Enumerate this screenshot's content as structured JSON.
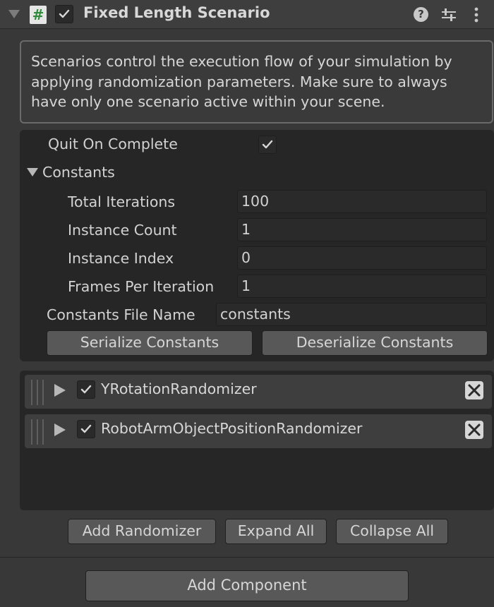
{
  "component": {
    "title": "Fixed Length Scenario",
    "script_icon_glyph": "#",
    "enabled": true
  },
  "help_text": "Scenarios control the execution flow of your simulation by applying randomization parameters. Make sure to always have only one scenario active within your scene.",
  "settings": {
    "quit_on_complete_label": "Quit On Complete",
    "quit_on_complete_value": true,
    "constants_foldout_label": "Constants",
    "constants": [
      {
        "label": "Total Iterations",
        "value": "100"
      },
      {
        "label": "Instance Count",
        "value": "1"
      },
      {
        "label": "Instance Index",
        "value": "0"
      },
      {
        "label": "Frames Per Iteration",
        "value": "1"
      }
    ],
    "constants_file_name_label": "Constants File Name",
    "constants_file_name_value": "constants",
    "serialize_button": "Serialize Constants",
    "deserialize_button": "Deserialize Constants"
  },
  "randomizers": [
    {
      "name": "YRotationRandomizer",
      "enabled": true
    },
    {
      "name": "RobotArmObjectPositionRandomizer",
      "enabled": true
    }
  ],
  "randomizer_buttons": {
    "add": "Add Randomizer",
    "expand": "Expand All",
    "collapse": "Collapse All"
  },
  "add_component_button": "Add Component",
  "icons": {
    "foldout": "triangle-down-icon",
    "script": "script-hash-icon",
    "help": "help-icon",
    "presets": "sliders-icon",
    "menu": "kebab-menu-icon",
    "drag": "drag-handle-icon",
    "expand": "triangle-right-icon",
    "remove": "close-icon"
  },
  "colors": {
    "background": "#383838",
    "panel": "#262626",
    "field": "#2a2a2a",
    "button": "#585858",
    "script_icon_hash": "#2f8a3a"
  }
}
